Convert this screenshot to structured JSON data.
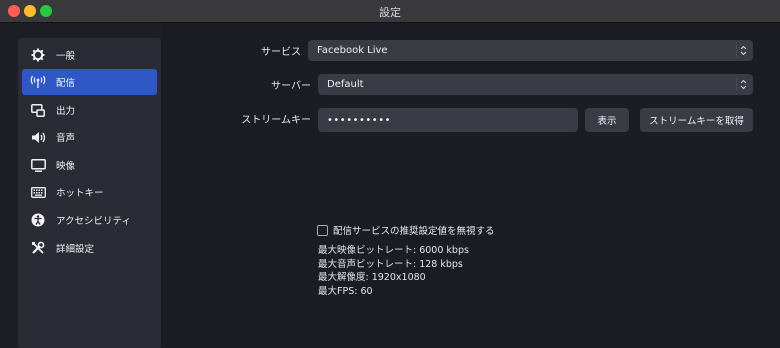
{
  "window": {
    "title": "設定"
  },
  "sidebar": {
    "items": [
      {
        "label": "一般",
        "icon": "gear-icon",
        "active": false
      },
      {
        "label": "配信",
        "icon": "antenna-icon",
        "active": true
      },
      {
        "label": "出力",
        "icon": "output-icon",
        "active": false
      },
      {
        "label": "音声",
        "icon": "speaker-icon",
        "active": false
      },
      {
        "label": "映像",
        "icon": "monitor-icon",
        "active": false
      },
      {
        "label": "ホットキー",
        "icon": "keyboard-icon",
        "active": false
      },
      {
        "label": "アクセシビリティ",
        "icon": "accessibility-icon",
        "active": false
      },
      {
        "label": "詳細設定",
        "icon": "tools-icon",
        "active": false
      }
    ]
  },
  "stream": {
    "service_label": "サービス",
    "service_value": "Facebook Live",
    "server_label": "サーバー",
    "server_value": "Default",
    "key_label": "ストリームキー",
    "key_value": "••••••••••",
    "show_button": "表示",
    "get_key_button": "ストリームキーを取得",
    "ignore_checkbox_label": "配信サービスの推奨設定値を無視する",
    "ignore_checked": false,
    "info": [
      "最大映像ビットレート: 6000 kbps",
      "最大音声ビットレート: 128 kbps",
      "最大解像度: 1920x1080",
      "最大FPS: 60"
    ]
  },
  "colors": {
    "accent": "#2f58c6",
    "background": "#1c1d24",
    "sidebar": "#2a2b34",
    "control": "#3a3b44"
  }
}
